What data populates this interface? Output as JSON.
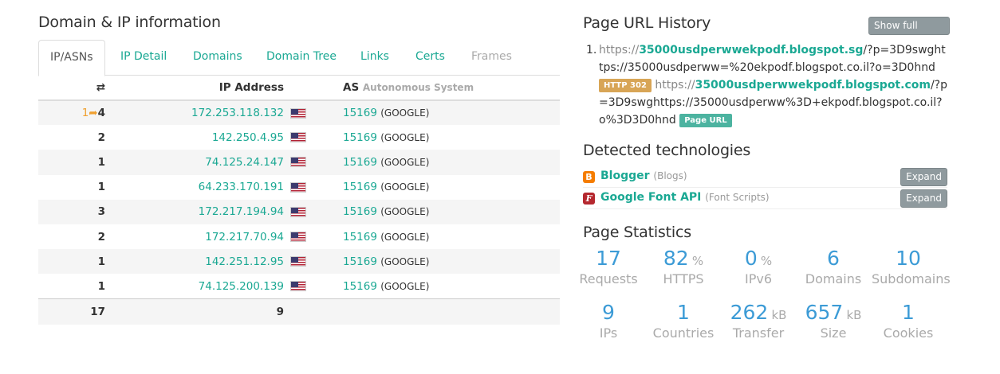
{
  "domain_ip": {
    "title": "Domain & IP information",
    "tabs": [
      "IP/ASNs",
      "IP Detail",
      "Domains",
      "Domain Tree",
      "Links",
      "Certs",
      "Frames"
    ],
    "columns": {
      "count_icon": "⇄",
      "ip": "IP Address",
      "as": "AS",
      "as_sub": "Autonomous System"
    },
    "rows": [
      {
        "redirect": "1",
        "count": "4",
        "ip": "172.253.118.132",
        "asn": "15169",
        "as_name": "(GOOGLE)"
      },
      {
        "redirect": "",
        "count": "2",
        "ip": "142.250.4.95",
        "asn": "15169",
        "as_name": "(GOOGLE)"
      },
      {
        "redirect": "",
        "count": "1",
        "ip": "74.125.24.147",
        "asn": "15169",
        "as_name": "(GOOGLE)"
      },
      {
        "redirect": "",
        "count": "1",
        "ip": "64.233.170.191",
        "asn": "15169",
        "as_name": "(GOOGLE)"
      },
      {
        "redirect": "",
        "count": "3",
        "ip": "172.217.194.94",
        "asn": "15169",
        "as_name": "(GOOGLE)"
      },
      {
        "redirect": "",
        "count": "2",
        "ip": "172.217.70.94",
        "asn": "15169",
        "as_name": "(GOOGLE)"
      },
      {
        "redirect": "",
        "count": "1",
        "ip": "142.251.12.95",
        "asn": "15169",
        "as_name": "(GOOGLE)"
      },
      {
        "redirect": "",
        "count": "1",
        "ip": "74.125.200.139",
        "asn": "15169",
        "as_name": "(GOOGLE)"
      }
    ],
    "totals": {
      "count": "17",
      "ips": "9"
    },
    "flag_icon": "us-flag-icon"
  },
  "url_history": {
    "title": "Page URL History",
    "show_full_button": "Show full URLs",
    "number": "1.",
    "url1": {
      "proto": "https://",
      "host": "35000usdperwwekpodf.blogspot.sg",
      "rest": "/?p=3D9swghttps://35000usdperww=%20ekpodf.blogspot.co.il?o=3D0hnd",
      "badge": "HTTP 302"
    },
    "url2": {
      "proto": "https://",
      "host": "35000usdperwwekpodf.blogspot.com",
      "rest": "/?p=3D9swghttps://35000usdperww%3D+ekpodf.blogspot.co.il?o%3D3D0hnd",
      "badge": "Page URL"
    }
  },
  "technologies": {
    "title": "Detected technologies",
    "items": [
      {
        "name": "Blogger",
        "category": "(Blogs)",
        "icon": "blogger-icon",
        "color": "#f57d00",
        "glyph": "B",
        "button": "Expand"
      },
      {
        "name": "Google Font API",
        "category": "(Font Scripts)",
        "icon": "google-font-icon",
        "color": "#b5282f",
        "glyph": "F",
        "button": "Expand"
      }
    ]
  },
  "stats": {
    "title": "Page Statistics",
    "items": [
      {
        "value": "17",
        "unit": "",
        "label": "Requests"
      },
      {
        "value": "82",
        "unit": "%",
        "label": "HTTPS"
      },
      {
        "value": "0",
        "unit": "%",
        "label": "IPv6"
      },
      {
        "value": "6",
        "unit": "",
        "label": "Domains"
      },
      {
        "value": "10",
        "unit": "",
        "label": "Subdomains"
      },
      {
        "value": "9",
        "unit": "",
        "label": "IPs"
      },
      {
        "value": "1",
        "unit": "",
        "label": "Countries"
      },
      {
        "value": "262",
        "unit": "kB",
        "label": "Transfer"
      },
      {
        "value": "657",
        "unit": "kB",
        "label": "Size"
      },
      {
        "value": "1",
        "unit": "",
        "label": "Cookies"
      }
    ]
  },
  "colors": {
    "accent": "#1aa893",
    "stat_blue": "#3c9bd6",
    "redirect_orange": "#f0a030"
  }
}
